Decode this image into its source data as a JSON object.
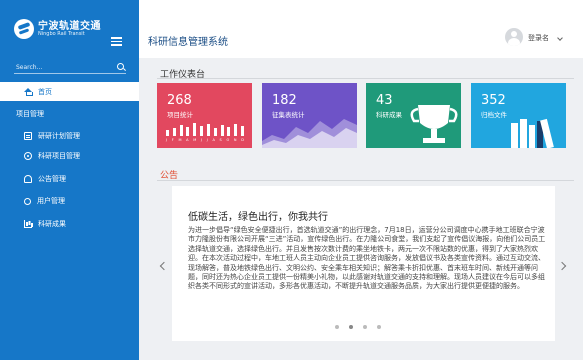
{
  "sidebar": {
    "brand_cn": "宁波轨道交通",
    "brand_en": "Ningbo Rail Transit",
    "search_placeholder": "Search...",
    "home_label": "首页",
    "group_label": "项目管理",
    "items": [
      {
        "label": "研研计划管理",
        "icon": "list-icon"
      },
      {
        "label": "科研项目管理",
        "icon": "gear-icon"
      },
      {
        "label": "公告管理",
        "icon": "bell-icon"
      },
      {
        "label": "用户管理",
        "icon": "user-icon"
      },
      {
        "label": "科研成果",
        "icon": "chart-icon"
      }
    ]
  },
  "header": {
    "title": "科研信息管理系统",
    "user_label": "登录名"
  },
  "dashboard": {
    "title": "工作仪表台",
    "cards": [
      {
        "number": "268",
        "label": "项目统计",
        "color": "#e2485f"
      },
      {
        "number": "182",
        "label": "征集表统计",
        "color": "#6e53c7"
      },
      {
        "number": "43",
        "label": "科研成果",
        "color": "#1f9a7a"
      },
      {
        "number": "352",
        "label": "归档文件",
        "color": "#21a6df"
      }
    ],
    "month_labels": [
      "J",
      "F",
      "M",
      "A",
      "M",
      "J",
      "J",
      "A",
      "S",
      "O",
      "N",
      "D"
    ]
  },
  "announcement": {
    "section_title": "公告",
    "title": "低碳生活，绿色出行，你我共行",
    "body": "为进一步倡导“绿色安全便捷出行，首选轨道交通”的出行理念，7月18日，运营分公司调度中心携手地工班联合宁波市力隆股份有限公司开展“三进”活动，宣传绿色出行。在力隆公司食堂，我们支起了宣传倡议海报，向他们公司员工选择轨道交通，选择绿色出行。并且发售按次数计费的乘坐地铁卡，两元一次不限站数的优惠，得到了大家热烈欢迎。在本次活动过程中，车地工班人员主动向企业员工提供咨询服务，发放倡议书及各类宣传资料。通过互动交流、现场解答，普及地铁绿色出行、文明公约、安全乘车相关知识；解答乘卡折扣优惠、首末班车时间、新线开通等问题，同时还为热心企业员工提供一份精美小礼物，以此感谢对轨道交通的支持和理解。现场人员建议在今后可以多组织各类不同形式的宣讲活动，多形各优惠活动，不断提升轨道交通服务品质，为大家出行提供更便捷的服务。"
  }
}
